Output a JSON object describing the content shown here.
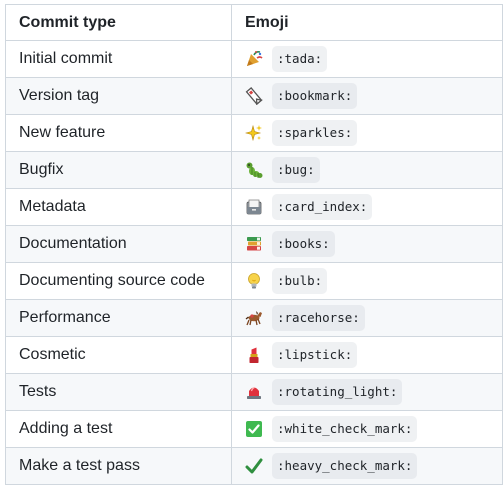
{
  "table": {
    "headers": [
      "Commit type",
      "Emoji"
    ],
    "rows": [
      {
        "type": "Initial commit",
        "code": ":tada:",
        "icon": "party-popper-icon"
      },
      {
        "type": "Version tag",
        "code": ":bookmark:",
        "icon": "bookmark-icon"
      },
      {
        "type": "New feature",
        "code": ":sparkles:",
        "icon": "sparkles-icon"
      },
      {
        "type": "Bugfix",
        "code": ":bug:",
        "icon": "bug-icon"
      },
      {
        "type": "Metadata",
        "code": ":card_index:",
        "icon": "card-index-icon"
      },
      {
        "type": "Documentation",
        "code": ":books:",
        "icon": "books-icon"
      },
      {
        "type": "Documenting source code",
        "code": ":bulb:",
        "icon": "light-bulb-icon"
      },
      {
        "type": "Performance",
        "code": ":racehorse:",
        "icon": "racehorse-icon"
      },
      {
        "type": "Cosmetic",
        "code": ":lipstick:",
        "icon": "lipstick-icon"
      },
      {
        "type": "Tests",
        "code": ":rotating_light:",
        "icon": "rotating-light-icon"
      },
      {
        "type": "Adding a test",
        "code": ":white_check_mark:",
        "icon": "white-check-mark-icon"
      },
      {
        "type": "Make a test pass",
        "code": ":heavy_check_mark:",
        "icon": "heavy-check-mark-icon"
      }
    ]
  }
}
